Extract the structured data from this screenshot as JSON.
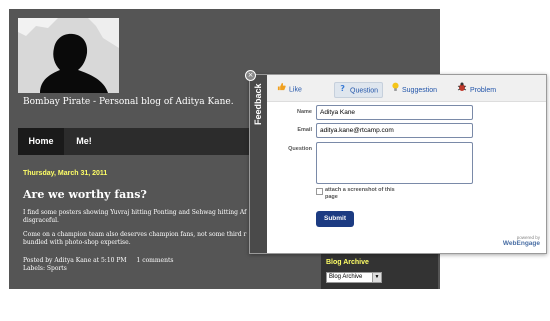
{
  "blog": {
    "title": "Bombay Pirate - Personal blog of Aditya Kane.",
    "nav": {
      "home": "Home",
      "me": "Me!"
    },
    "post": {
      "date": "Thursday, March 31, 2011",
      "title": "Are we worthy fans?",
      "paragraph1": "I find some posters showing Yuvraj hitting Ponting and Sehwag hitting Af disgraceful.",
      "paragraph2": "Come on a champion team also deserves champion fans, not some third r bundled with photo-shop expertise.",
      "posted_by": "Posted by Aditya Kane at 5:10 PM",
      "comments": "1 comments",
      "labels": "Labels: Sports"
    },
    "sidebar": {
      "archive_title": "Blog Archive",
      "archive_select": "Blog Archive"
    }
  },
  "feedback": {
    "tab_label": "Feedback",
    "close": "×",
    "tabs": [
      {
        "label": "Like",
        "icon": "thumbs-up-icon"
      },
      {
        "label": "Question",
        "icon": "question-icon"
      },
      {
        "label": "Suggestion",
        "icon": "lightbulb-icon"
      },
      {
        "label": "Problem",
        "icon": "bug-icon"
      }
    ],
    "selected_tab": "Question",
    "name_label": "Name",
    "name_value": "Aditya Kane",
    "email_label": "Email",
    "email_value": "aditya.kane@rtcamp.com",
    "question_label": "Question",
    "question_value": "",
    "screenshot_label": "attach a screenshot of this page",
    "submit_label": "Submit",
    "powered_by": "powered by",
    "brand": "WebEngage"
  }
}
